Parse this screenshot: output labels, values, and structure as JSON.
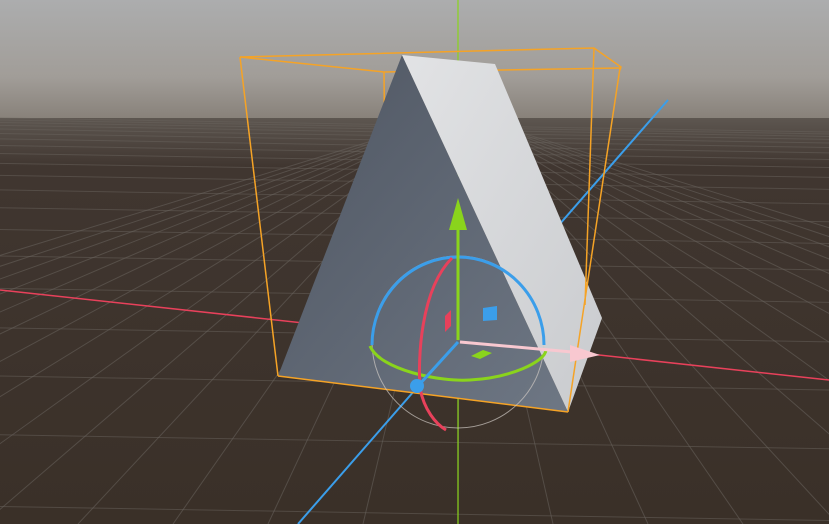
{
  "editor": {
    "viewport_name": "3D viewport",
    "selected_object": "prism-mesh",
    "colors": {
      "sky_top": "#a9aaab",
      "sky_horizon": "#8d8a86",
      "ground": "#3a3028",
      "grid_line": "#6a645e",
      "x_axis": "#e8415b",
      "y_axis": "#8ad41c",
      "z_axis": "#3b9eea",
      "selection_box": "#f5a326",
      "prism_face_dark": "#5a626e",
      "prism_face_light": "#d5d7da",
      "gizmo_x": "#e8415b",
      "gizmo_y": "#8ad41c",
      "gizmo_z": "#3b9eea",
      "gizmo_arrow_x": "#f8c8d0"
    },
    "gizmo": {
      "mode": "transform",
      "handles": [
        "move-x-arrow",
        "move-y-arrow",
        "move-z-arrow",
        "rotate-x-ring",
        "rotate-y-ring",
        "rotate-z-ring",
        "plane-xy",
        "plane-xz",
        "plane-yz"
      ]
    }
  }
}
